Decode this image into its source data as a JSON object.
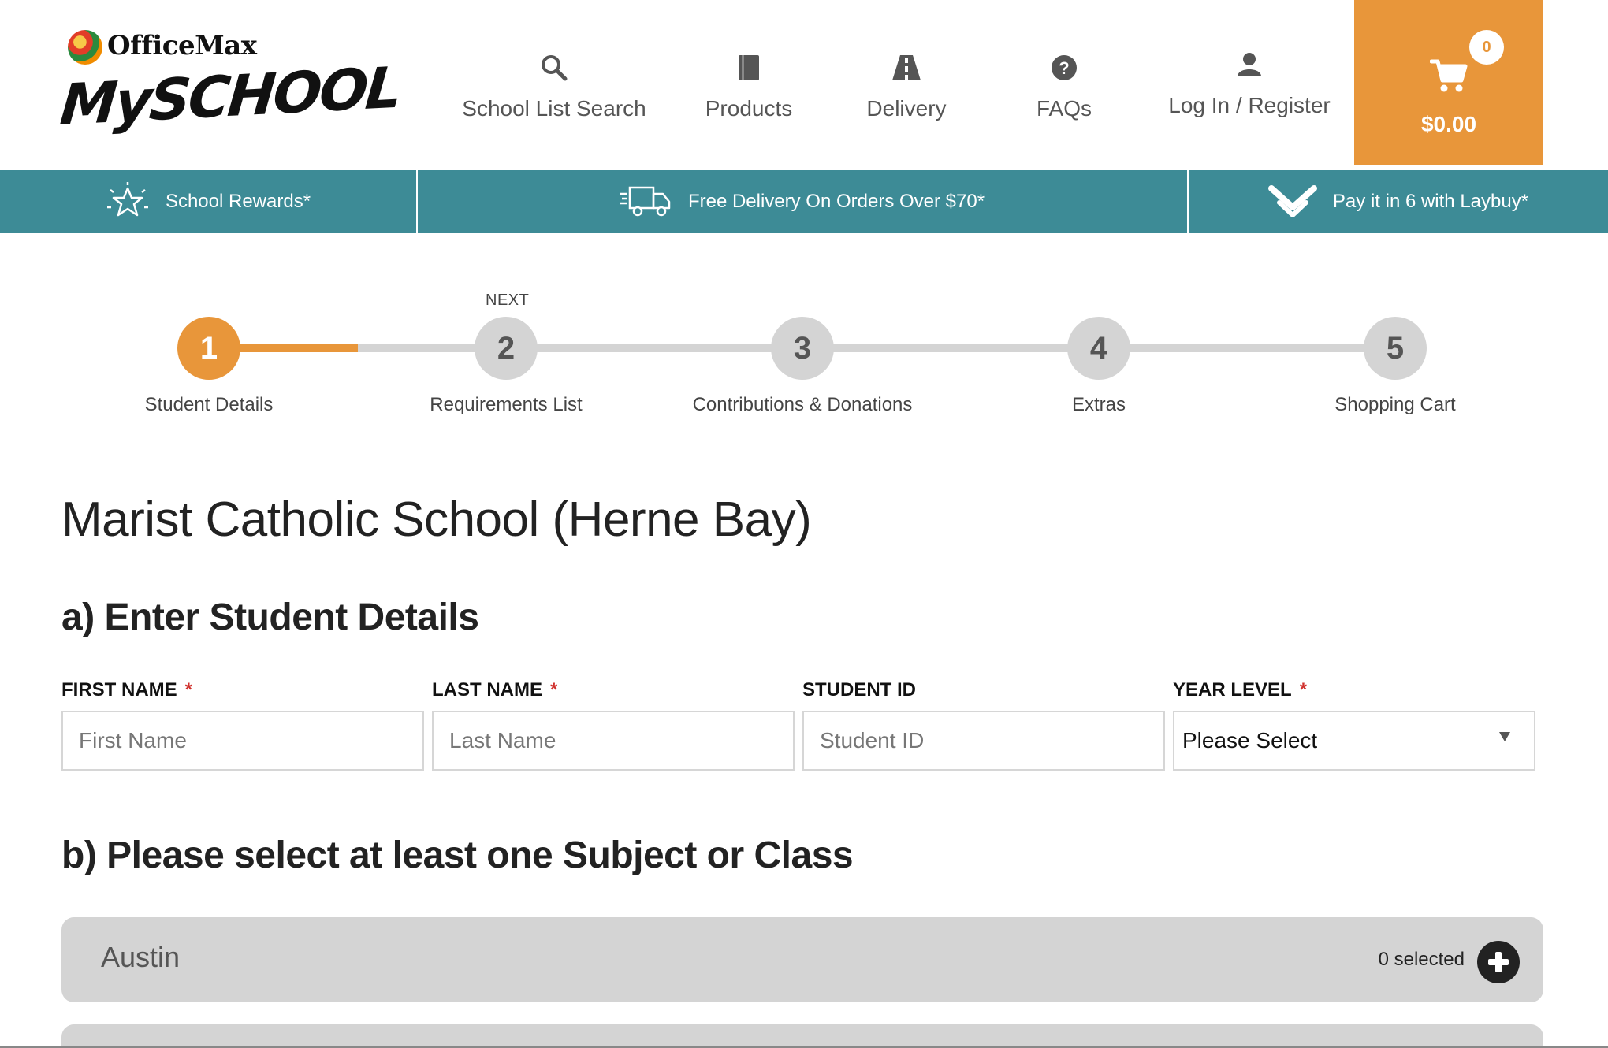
{
  "brand": {
    "logo_top": "OfficeMax",
    "logo_main": "MySCHOOL"
  },
  "nav": {
    "items": [
      {
        "label": "School List Search",
        "icon": "search-icon"
      },
      {
        "label": "Products",
        "icon": "book-icon"
      },
      {
        "label": "Delivery",
        "icon": "road-icon"
      },
      {
        "label": "FAQs",
        "icon": "question-icon"
      },
      {
        "label": "Log In / Register",
        "icon": "user-icon"
      }
    ]
  },
  "cart": {
    "count": "0",
    "total": "$0.00",
    "icon": "cart-icon",
    "color": "#e8963a"
  },
  "promo": {
    "color": "#3d8b96",
    "items": [
      {
        "label": "School Rewards*",
        "icon": "starburst-icon"
      },
      {
        "label": "Free Delivery On Orders Over $70*",
        "icon": "truck-icon"
      },
      {
        "label": "Pay it in 6 with Laybuy*",
        "icon": "laybuy-icon"
      }
    ]
  },
  "stepper": {
    "next_label": "NEXT",
    "current": 1,
    "steps": [
      {
        "number": "1",
        "label": "Student Details"
      },
      {
        "number": "2",
        "label": "Requirements List"
      },
      {
        "number": "3",
        "label": "Contributions & Donations"
      },
      {
        "number": "4",
        "label": "Extras"
      },
      {
        "number": "5",
        "label": "Shopping Cart"
      }
    ]
  },
  "page": {
    "school_name": "Marist Catholic School (Herne Bay)",
    "section_a_title": "a) Enter Student Details",
    "section_b_title": "b) Please select at least one Subject or Class"
  },
  "form": {
    "first_name": {
      "label": "FIRST NAME",
      "required_mark": "*",
      "placeholder": "First Name",
      "value": ""
    },
    "last_name": {
      "label": "LAST NAME",
      "required_mark": "*",
      "placeholder": "Last Name",
      "value": ""
    },
    "student_id": {
      "label": "STUDENT ID",
      "placeholder": "Student ID",
      "value": ""
    },
    "year_level": {
      "label": "YEAR LEVEL",
      "required_mark": "*",
      "selected": "Please Select"
    }
  },
  "classes": [
    {
      "name": "Austin",
      "selected_text": "0 selected"
    }
  ]
}
